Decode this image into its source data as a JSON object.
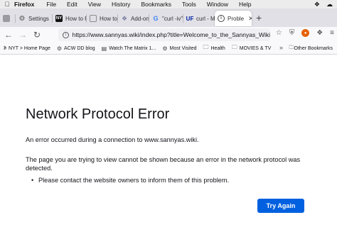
{
  "menubar": {
    "apple": "",
    "items": [
      "Firefox",
      "File",
      "Edit",
      "View",
      "History",
      "Bookmarks",
      "Tools",
      "Window",
      "Help"
    ],
    "right_icons": [
      "dropbox-icon",
      "cloud-icon"
    ]
  },
  "tabs": [
    {
      "title": "",
      "icon": "pinned-tab-icon",
      "color": "#9a9aa0"
    },
    {
      "title": "Settings",
      "icon": "gear-icon",
      "color": "#555555"
    },
    {
      "title": "How to Fi",
      "icon": "nyt-favicon",
      "color": "#111111",
      "badge": "NY"
    },
    {
      "title": "How to E",
      "icon": "page-icon",
      "color": "#8c8c8c"
    },
    {
      "title": "Add-ons",
      "icon": "puzzle-icon",
      "color": "#7a7aa0"
    },
    {
      "title": "\"curl -iv\"",
      "icon": "google-icon",
      "color": "#4285f4",
      "badge": "G"
    },
    {
      "title": "curl - Me",
      "icon": "uf-icon",
      "color": "#0021a5",
      "badge": "UF"
    },
    {
      "title": "Proble",
      "icon": "info-icon",
      "color": "#ffffff",
      "active": true
    }
  ],
  "nav": {
    "back": "←",
    "forward": "→",
    "reload": "C",
    "url": "https://www.sannyas.wiki/index.php?title=Welcome_to_the_Sannyas_Wiki"
  },
  "bookmarks": [
    {
      "label": "NYT > Home Page",
      "icon": "nyt-icon"
    },
    {
      "label": "ACW DD blog",
      "icon": "gear-icon"
    },
    {
      "label": "Watch The Matrix 1...",
      "icon": "film-icon"
    },
    {
      "label": "Most Visited",
      "icon": "gear-icon"
    },
    {
      "label": "Health",
      "icon": "folder-icon"
    },
    {
      "label": "MOVIES & TV",
      "icon": "folder-icon"
    }
  ],
  "other_bookmarks": "Other Bookmarks",
  "error": {
    "title": "Network Protocol Error",
    "intro": "An error occurred during a connection to www.sannyas.wiki.",
    "detail": "The page you are trying to view cannot be shown because an error in the network protocol was detected.",
    "bullet": "Please contact the website owners to inform them of this problem.",
    "button": "Try Again"
  },
  "colors": {
    "accent": "#0061e0",
    "tabstrip": "#e0e0e6"
  }
}
